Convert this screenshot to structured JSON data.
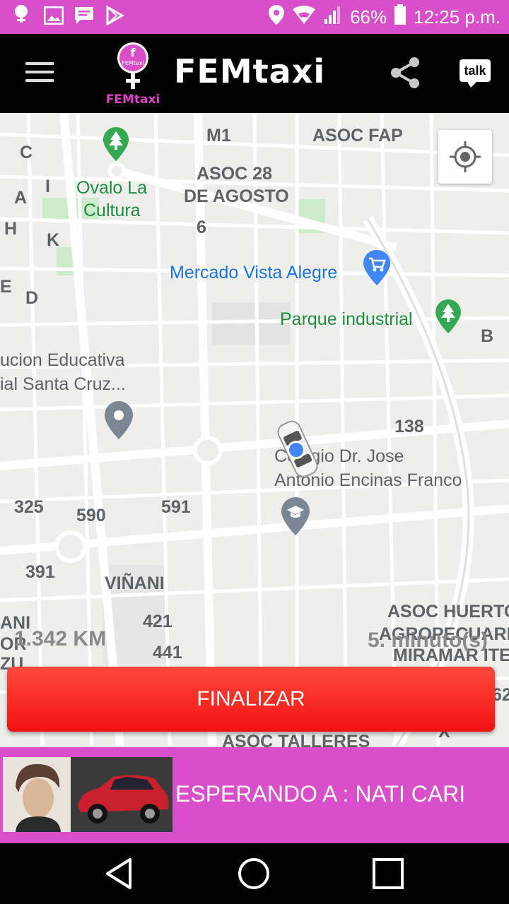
{
  "status_bar": {
    "battery": "66%",
    "time": "12:25 p.m."
  },
  "header": {
    "app_title": "FEMtaxi",
    "logo_top_text": "FEMtaxi",
    "logo_bottom_text": "FEMtaxi",
    "talk_label": "talk",
    "icons": [
      "menu-icon",
      "share-icon",
      "talk-icon"
    ]
  },
  "map": {
    "labels": {
      "m1": "M1",
      "asoc_fap": "ASOC FAP",
      "c": "C",
      "a": "A",
      "i": "I",
      "h": "H",
      "k": "K",
      "e": "E",
      "d": "D",
      "b": "B",
      "ovalo_1": "Ovalo La",
      "ovalo_2": "Cultura",
      "asoc28_1": "ASOC 28",
      "asoc28_2": "DE AGOSTO",
      "six": "6",
      "mercado": "Mercado Vista Alegre",
      "parque": "Parque industrial",
      "inst_1": "ucion Educativa",
      "inst_2": "ial Santa Cruz...",
      "n138": "138",
      "colegio_1": "Colegio Dr. Jose",
      "colegio_2": "Antonio Encinas Franco",
      "n325": "325",
      "n590": "590",
      "n591": "591",
      "n391": "391",
      "vinani": "VIÑANI",
      "n421": "421",
      "n441": "441",
      "ani": "ANI",
      "or": "OR",
      "zu": "ZU",
      "huerto_1": "ASOC HUERTO",
      "huerto_2": "AGROPECUARIO",
      "huerto_3": "MIRAMAR ITE",
      "n62": "62",
      "talleres": "ASOC TALLERES",
      "x": "X"
    },
    "distance": "1.342 KM",
    "duration": "5. minuto(s)"
  },
  "finalize_button": "FINALIZAR",
  "wait_bar": {
    "text": "ESPERANDO A : NATI CARI"
  },
  "colors": {
    "brand_pink": "#d94fc9",
    "finalize_red": "#f21210"
  }
}
